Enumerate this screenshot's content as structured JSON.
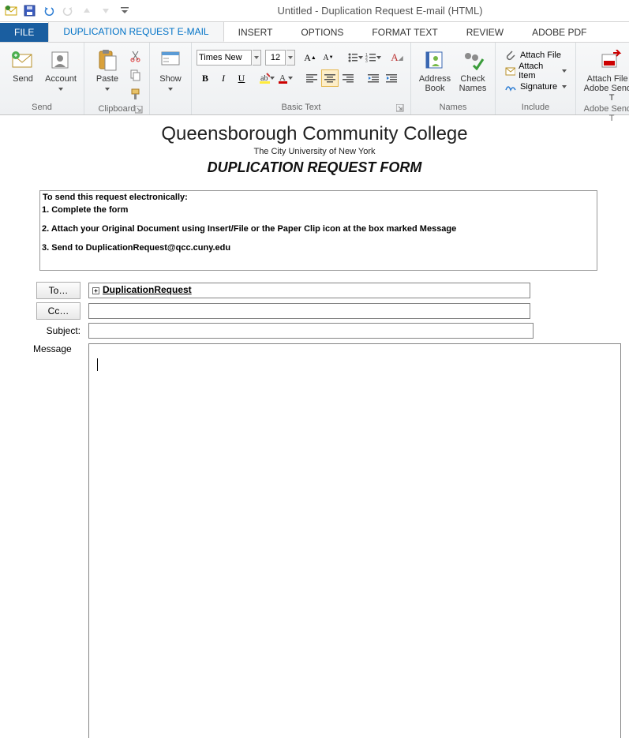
{
  "titlebar": {
    "title": "Untitled - Duplication Request E-mail (HTML)"
  },
  "tabs": {
    "file": "FILE",
    "main": "DUPLICATION REQUEST E-MAIL",
    "insert": "INSERT",
    "options": "OPTIONS",
    "format": "FORMAT TEXT",
    "review": "REVIEW",
    "adobe": "ADOBE PDF"
  },
  "ribbon": {
    "send": {
      "label": "Send",
      "account_label": "Account",
      "group": "Send"
    },
    "clipboard": {
      "paste_label": "Paste",
      "group": "Clipboard"
    },
    "show": {
      "label": "Show",
      "group": ""
    },
    "basic_text": {
      "font": "Times New",
      "size": "12",
      "group": "Basic Text"
    },
    "names": {
      "address_label": "Address Book",
      "check_label": "Check Names",
      "group": "Names"
    },
    "include": {
      "attach_file": "Attach File",
      "attach_item": "Attach Item",
      "signature": "Signature",
      "group": "Include"
    },
    "adobe": {
      "attach_via": "Attach File vi",
      "send": "Adobe Send & T",
      "group": "Adobe Send & T"
    }
  },
  "doc": {
    "college": "Queensborough Community College",
    "university": "The City University of New York",
    "form_title": "DUPLICATION REQUEST FORM",
    "instr_header": "To send this request electronically:",
    "step1": "1. Complete the form",
    "step2": "2. Attach your Original Document using Insert/File or the Paper Clip icon at the box marked Message",
    "step3": "3. Send to DuplicationRequest@qcc.cuny.edu"
  },
  "fields": {
    "to_label": "To…",
    "to_value": "DuplicationRequest",
    "cc_label": "Cc…",
    "cc_value": "",
    "subject_label": "Subject:",
    "subject_value": "",
    "message_label": "Message"
  }
}
